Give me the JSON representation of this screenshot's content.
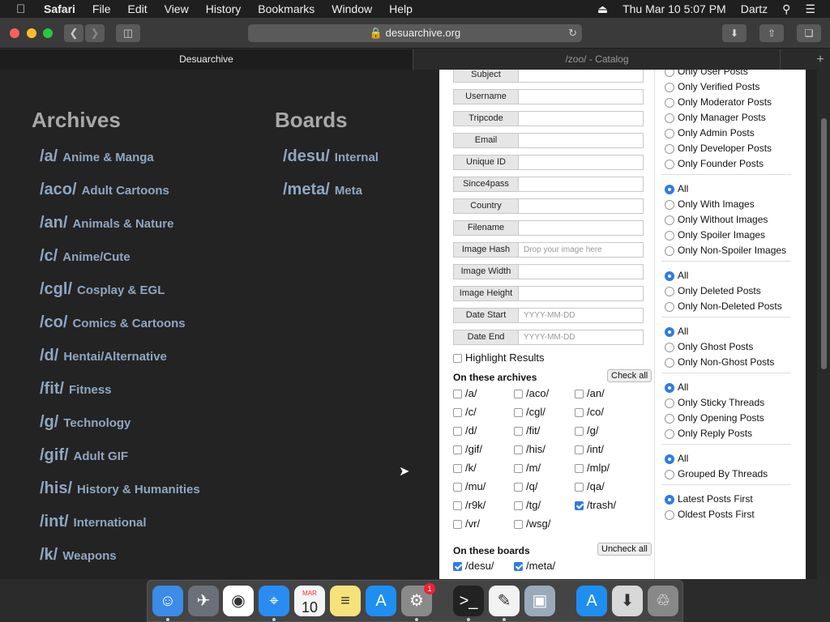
{
  "menubar": {
    "apple": "",
    "app": "Safari",
    "items": [
      "File",
      "Edit",
      "View",
      "History",
      "Bookmarks",
      "Window",
      "Help"
    ],
    "clock": "Thu Mar 10  5:07 PM",
    "user": "Dartz"
  },
  "toolbar": {
    "url": "desuarchive.org",
    "sidebar_icon": "sidebar-icon"
  },
  "tabs": {
    "tab1": "Desuarchive",
    "tab2": "/zoo/ - Catalog",
    "new_tab": "+"
  },
  "archives": {
    "title": "Archives",
    "items": [
      {
        "code": "/a/",
        "name": "Anime & Manga"
      },
      {
        "code": "/aco/",
        "name": "Adult Cartoons"
      },
      {
        "code": "/an/",
        "name": "Animals & Nature"
      },
      {
        "code": "/c/",
        "name": "Anime/Cute"
      },
      {
        "code": "/cgl/",
        "name": "Cosplay & EGL"
      },
      {
        "code": "/co/",
        "name": "Comics & Cartoons"
      },
      {
        "code": "/d/",
        "name": "Hentai/Alternative"
      },
      {
        "code": "/fit/",
        "name": "Fitness"
      },
      {
        "code": "/g/",
        "name": "Technology"
      },
      {
        "code": "/gif/",
        "name": "Adult GIF"
      },
      {
        "code": "/his/",
        "name": "History & Humanities"
      },
      {
        "code": "/int/",
        "name": "International"
      },
      {
        "code": "/k/",
        "name": "Weapons"
      }
    ]
  },
  "boards": {
    "title": "Boards",
    "items": [
      {
        "code": "/desu/",
        "name": "Internal"
      },
      {
        "code": "/meta/",
        "name": "Meta"
      }
    ]
  },
  "search": {
    "fields": [
      {
        "label": "Subject",
        "placeholder": ""
      },
      {
        "label": "Username",
        "placeholder": ""
      },
      {
        "label": "Tripcode",
        "placeholder": ""
      },
      {
        "label": "Email",
        "placeholder": ""
      },
      {
        "label": "Unique ID",
        "placeholder": ""
      },
      {
        "label": "Since4pass",
        "placeholder": ""
      },
      {
        "label": "Country",
        "placeholder": ""
      },
      {
        "label": "Filename",
        "placeholder": ""
      },
      {
        "label": "Image Hash",
        "placeholder": "Drop your image here"
      },
      {
        "label": "Image Width",
        "placeholder": ""
      },
      {
        "label": "Image Height",
        "placeholder": ""
      },
      {
        "label": "Date Start",
        "placeholder": "YYYY-MM-DD"
      },
      {
        "label": "Date End",
        "placeholder": "YYYY-MM-DD"
      }
    ],
    "highlight": "Highlight Results",
    "archives_title": "On these archives",
    "check_all": "Check all",
    "archive_checks": [
      {
        "label": "/a/",
        "checked": false
      },
      {
        "label": "/aco/",
        "checked": false
      },
      {
        "label": "/an/",
        "checked": false
      },
      {
        "label": "/c/",
        "checked": false
      },
      {
        "label": "/cgl/",
        "checked": false
      },
      {
        "label": "/co/",
        "checked": false
      },
      {
        "label": "/d/",
        "checked": false
      },
      {
        "label": "/fit/",
        "checked": false
      },
      {
        "label": "/g/",
        "checked": false
      },
      {
        "label": "/gif/",
        "checked": false
      },
      {
        "label": "/his/",
        "checked": false
      },
      {
        "label": "/int/",
        "checked": false
      },
      {
        "label": "/k/",
        "checked": false
      },
      {
        "label": "/m/",
        "checked": false
      },
      {
        "label": "/mlp/",
        "checked": false
      },
      {
        "label": "/mu/",
        "checked": false
      },
      {
        "label": "/q/",
        "checked": false
      },
      {
        "label": "/qa/",
        "checked": false
      },
      {
        "label": "/r9k/",
        "checked": false
      },
      {
        "label": "/tg/",
        "checked": false
      },
      {
        "label": "/trash/",
        "checked": true
      },
      {
        "label": "/vr/",
        "checked": false
      },
      {
        "label": "/wsg/",
        "checked": false
      }
    ],
    "boards_title": "On these boards",
    "uncheck_all": "Uncheck all",
    "board_checks": [
      {
        "label": "/desu/",
        "checked": true
      },
      {
        "label": "/meta/",
        "checked": true
      }
    ]
  },
  "filters": {
    "groups": [
      [
        "Only User Posts",
        "Only Verified Posts",
        "Only Moderator Posts",
        "Only Manager Posts",
        "Only Admin Posts",
        "Only Developer Posts",
        "Only Founder Posts"
      ],
      [
        "All",
        "Only With Images",
        "Only Without Images",
        "Only Spoiler Images",
        "Only Non-Spoiler Images"
      ],
      [
        "All",
        "Only Deleted Posts",
        "Only Non-Deleted Posts"
      ],
      [
        "All",
        "Only Ghost Posts",
        "Only Non-Ghost Posts"
      ],
      [
        "All",
        "Only Sticky Threads",
        "Only Opening Posts",
        "Only Reply Posts"
      ],
      [
        "All",
        "Grouped By Threads"
      ],
      [
        "Latest Posts First",
        "Oldest Posts First"
      ]
    ],
    "selected": [
      null,
      0,
      0,
      0,
      0,
      0,
      0
    ]
  },
  "dock": {
    "apps": [
      "finder-icon",
      "launchpad-icon",
      "chrome-icon",
      "safari-icon",
      "calendar-icon",
      "notes-icon",
      "app-store-icon",
      "system-preferences-icon",
      "terminal-icon",
      "textedit-icon",
      "preview-icon",
      "app-store-folder-icon",
      "downloads-icon",
      "trash-icon"
    ],
    "calendar_month": "MAR",
    "calendar_day": "10",
    "badge": "1"
  }
}
